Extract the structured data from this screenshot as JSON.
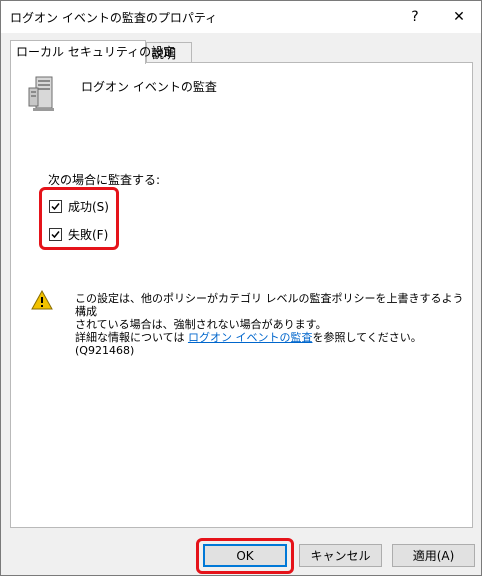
{
  "window": {
    "title": "ログオン イベントの監査のプロパティ",
    "help_glyph": "?",
    "close_glyph": "✕"
  },
  "tabs": [
    {
      "label": "ローカル セキュリティの設定",
      "active": true
    },
    {
      "label": "説明",
      "active": false
    }
  ],
  "policy": {
    "icon": "server-icon",
    "title": "ログオン イベントの監査"
  },
  "audit": {
    "label": "次の場合に監査する:",
    "options": [
      {
        "label": "成功(S)",
        "checked": true
      },
      {
        "label": "失敗(F)",
        "checked": true
      }
    ]
  },
  "warning": {
    "icon": "warning-icon",
    "line1": "この設定は、他のポリシーがカテゴリ レベルの監査ポリシーを上書きするよう構成",
    "line2": "されている場合は、強制されない場合があります。",
    "line3_prefix": "詳細な情報については ",
    "link": "ログオン イベントの監査",
    "line3_suffix": "を参照してください。(Q921468)"
  },
  "buttons": {
    "ok": "OK",
    "cancel": "キャンセル",
    "apply": "適用(A)"
  },
  "colors": {
    "highlight": "#e5131a",
    "focus": "#0078d7",
    "link": "#0066cc"
  }
}
